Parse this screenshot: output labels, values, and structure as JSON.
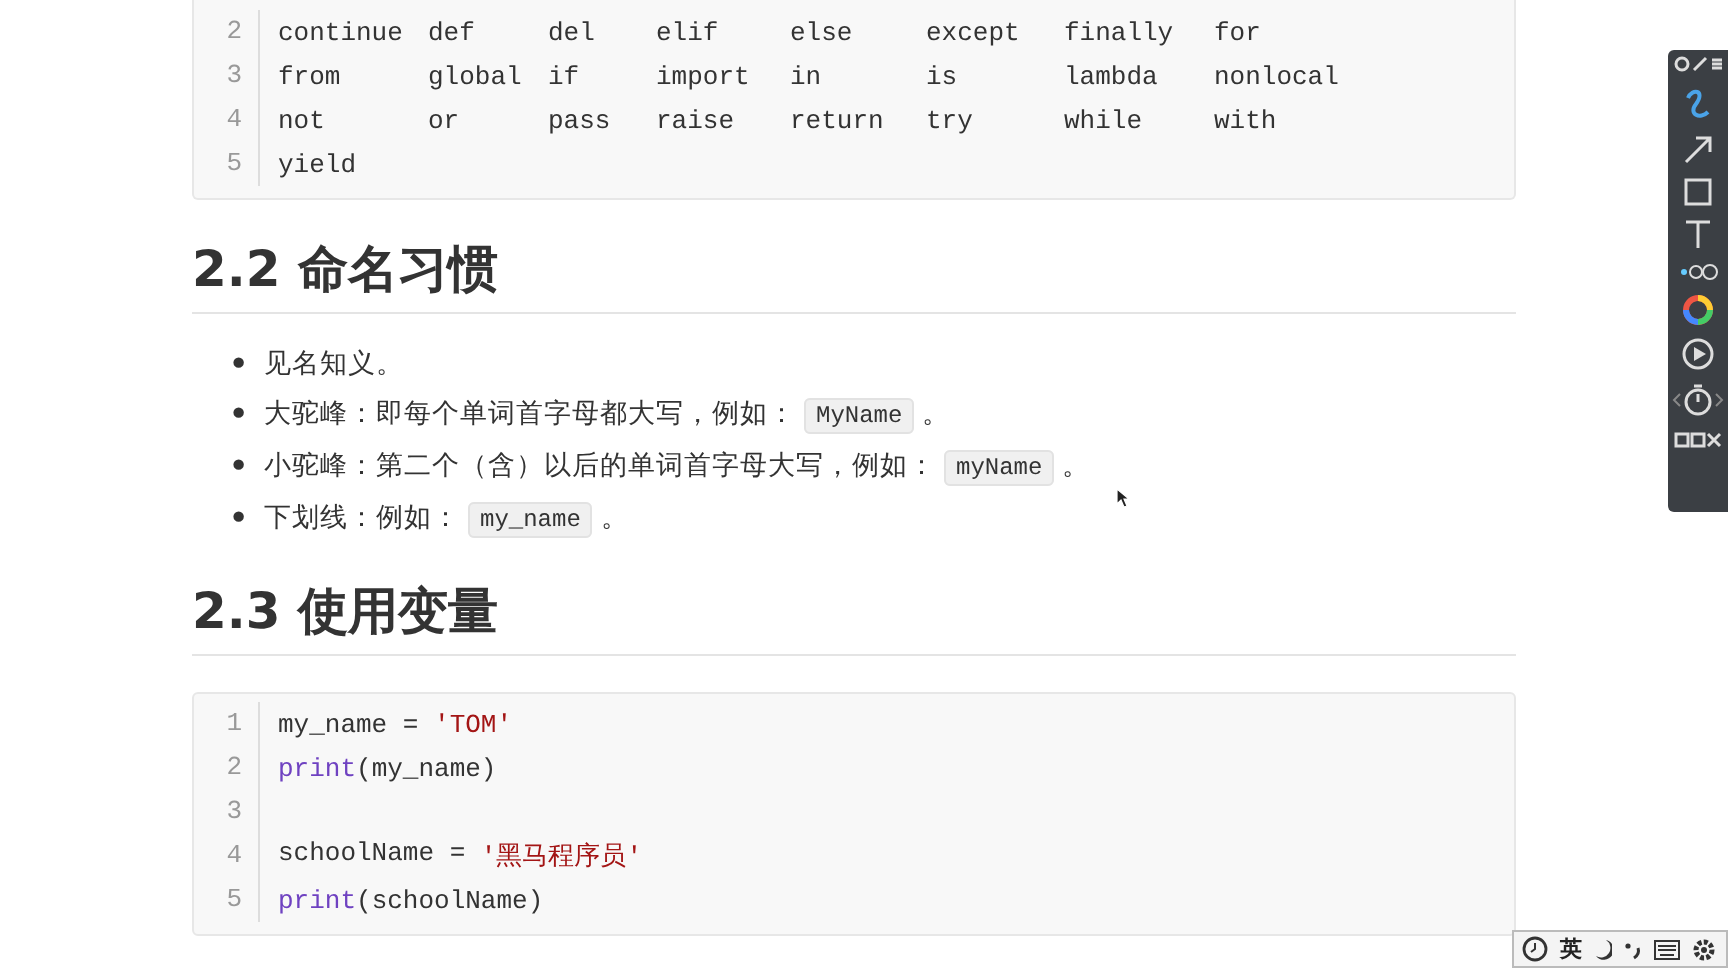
{
  "keyword_block": {
    "lines": [
      {
        "number": "2",
        "words": [
          "continue",
          "def",
          "del",
          "elif",
          "else",
          "except",
          "finally",
          "for"
        ]
      },
      {
        "number": "3",
        "words": [
          "from",
          "global",
          "if",
          "import",
          "in",
          "is",
          "lambda",
          "nonlocal"
        ]
      },
      {
        "number": "4",
        "words": [
          "not",
          "or",
          "pass",
          "raise",
          "return",
          "try",
          "while",
          "with"
        ]
      },
      {
        "number": "5",
        "words": [
          "yield"
        ]
      }
    ]
  },
  "sections": [
    {
      "heading": "2.2 命名习惯",
      "bullets": [
        {
          "marker": "•",
          "parts": [
            {
              "kind": "text",
              "text": "见名知义。"
            }
          ]
        },
        {
          "marker": "•",
          "parts": [
            {
              "kind": "text",
              "text": "大驼峰：即每个单词首字母都大写，例如："
            },
            {
              "kind": "code",
              "text": "MyName"
            },
            {
              "kind": "text",
              "text": "。"
            }
          ]
        },
        {
          "marker": "•",
          "parts": [
            {
              "kind": "text",
              "text": "小驼峰：第二个（含）以后的单词首字母大写，例如："
            },
            {
              "kind": "code",
              "text": "myName"
            },
            {
              "kind": "text",
              "text": "。"
            }
          ]
        },
        {
          "marker": "•",
          "parts": [
            {
              "kind": "text",
              "text": "下划线：例如："
            },
            {
              "kind": "code",
              "text": "my_name"
            },
            {
              "kind": "text",
              "text": "。"
            }
          ]
        }
      ]
    },
    {
      "heading": "2.3 使用变量",
      "code": [
        {
          "number": "1",
          "tokens": [
            {
              "kind": "plain",
              "text": "my_name = "
            },
            {
              "kind": "string",
              "text": "'TOM'"
            }
          ]
        },
        {
          "number": "2",
          "tokens": [
            {
              "kind": "builtin",
              "text": "print"
            },
            {
              "kind": "plain",
              "text": "(my_name)"
            }
          ]
        },
        {
          "number": "3"
        },
        {
          "number": "4",
          "tokens": [
            {
              "kind": "plain",
              "text": "schoolName = "
            },
            {
              "kind": "string",
              "text": "'黑马程序员'"
            }
          ]
        },
        {
          "number": "5",
          "tokens": [
            {
              "kind": "builtin",
              "text": "print"
            },
            {
              "kind": "plain",
              "text": "(schoolName)"
            }
          ]
        }
      ]
    }
  ],
  "ime_bar": {
    "language": "英"
  }
}
